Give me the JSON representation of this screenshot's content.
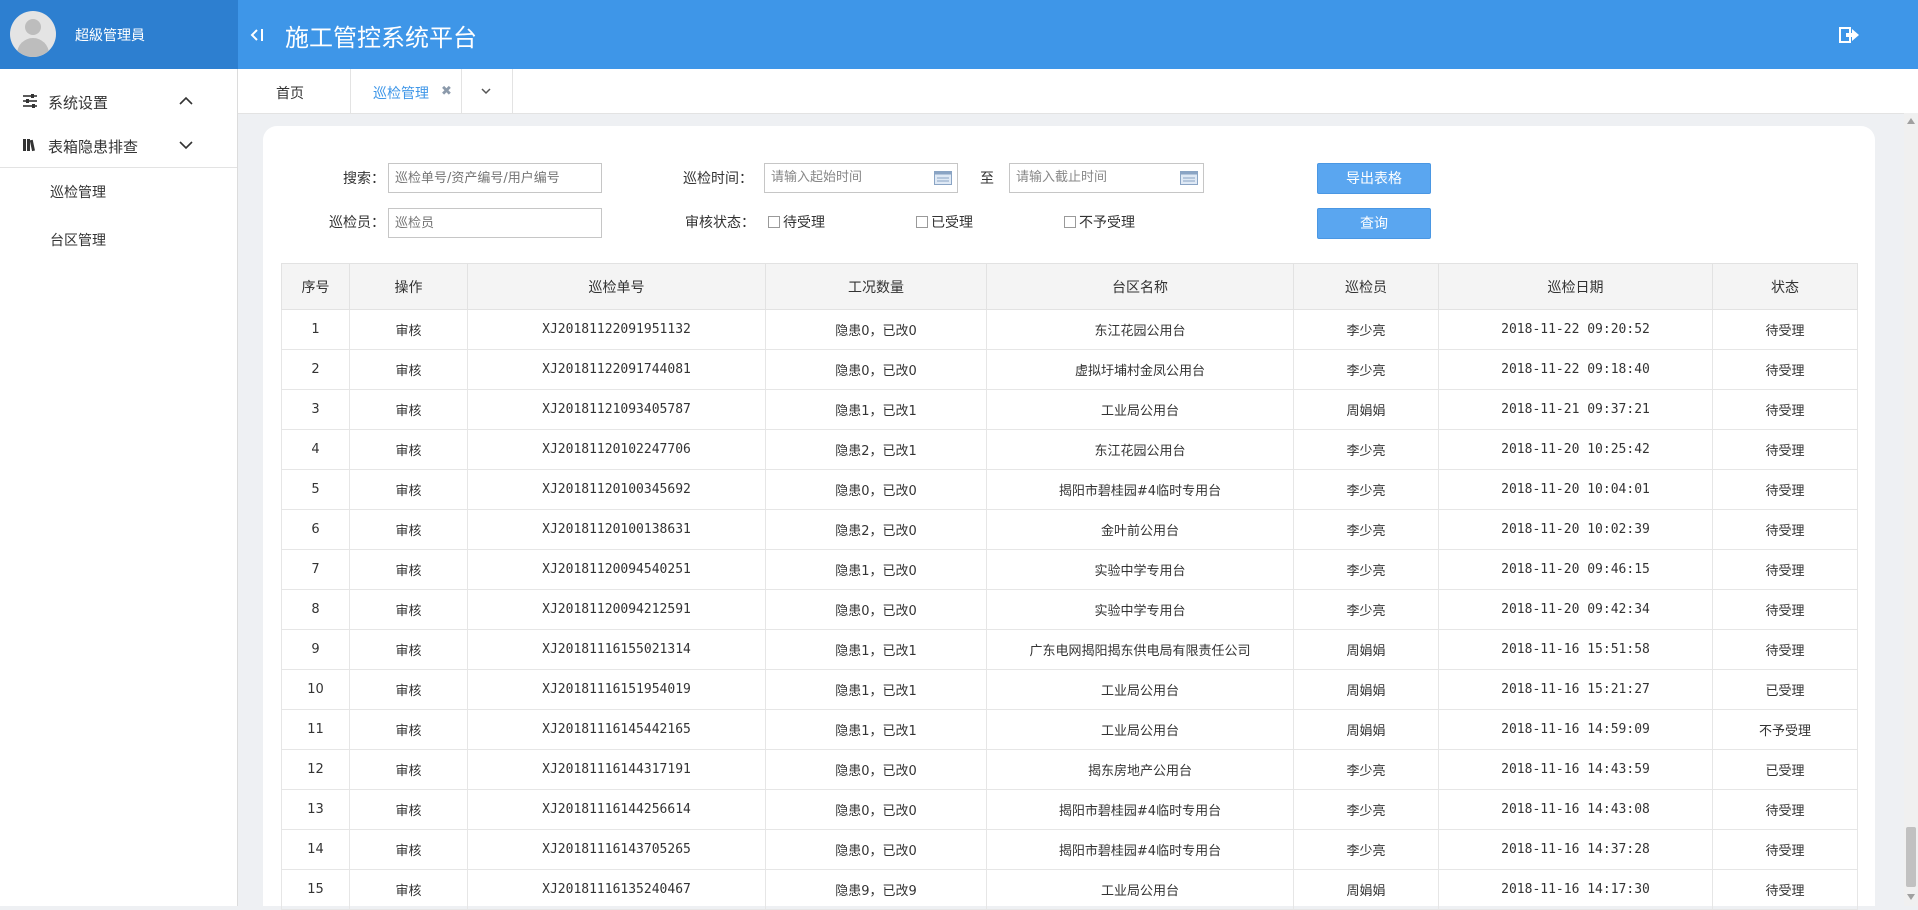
{
  "header": {
    "user_name": "超級管理員",
    "title": "施工管控系统平台",
    "accent_color": "#3e96e8",
    "icons": [
      "collapse-icon",
      "logout-icon",
      "avatar"
    ]
  },
  "sidebar": {
    "groups": [
      {
        "label": "系统设置",
        "icon": "sliders-icon",
        "chevron": "up"
      },
      {
        "label": "表箱隐患排查",
        "icon": "books-icon",
        "chevron": "down"
      }
    ],
    "items": [
      {
        "label": "巡检管理"
      },
      {
        "label": "台区管理"
      }
    ]
  },
  "tabs": [
    {
      "label": "首页"
    },
    {
      "label": "巡检管理",
      "active": true,
      "closable": true
    }
  ],
  "filters": {
    "search_label": "搜索：",
    "search_placeholder": "巡检单号/资产编号/用户编号",
    "inspector_label": "巡检员：",
    "inspector_placeholder": "巡检员",
    "time_label": "巡检时间：",
    "start_placeholder": "请输入起始时间",
    "to_label": "至",
    "end_placeholder": "请输入截止时间",
    "status_label": "审核状态：",
    "status_options": [
      "待受理",
      "已受理",
      "不予受理"
    ],
    "export_button": "导出表格",
    "query_button": "查询"
  },
  "table": {
    "headers": [
      "序号",
      "操作",
      "巡检单号",
      "工况数量",
      "台区名称",
      "巡检员",
      "巡检日期",
      "状态"
    ],
    "rows": [
      [
        "1",
        "审核",
        "XJ20181122091951132",
        "隐患0，已改0",
        "东江花园公用台",
        "李少亮",
        "2018-11-22 09:20:52",
        "待受理"
      ],
      [
        "2",
        "审核",
        "XJ20181122091744081",
        "隐患0，已改0",
        "虚拟圩埔村金凤公用台",
        "李少亮",
        "2018-11-22 09:18:40",
        "待受理"
      ],
      [
        "3",
        "审核",
        "XJ20181121093405787",
        "隐患1，已改1",
        "工业局公用台",
        "周娟娟",
        "2018-11-21 09:37:21",
        "待受理"
      ],
      [
        "4",
        "审核",
        "XJ20181120102247706",
        "隐患2，已改1",
        "东江花园公用台",
        "李少亮",
        "2018-11-20 10:25:42",
        "待受理"
      ],
      [
        "5",
        "审核",
        "XJ20181120100345692",
        "隐患0，已改0",
        "揭阳市碧桂园#4临时专用台",
        "李少亮",
        "2018-11-20 10:04:01",
        "待受理"
      ],
      [
        "6",
        "审核",
        "XJ20181120100138631",
        "隐患2，已改0",
        "金叶前公用台",
        "李少亮",
        "2018-11-20 10:02:39",
        "待受理"
      ],
      [
        "7",
        "审核",
        "XJ20181120094540251",
        "隐患1，已改0",
        "实验中学专用台",
        "李少亮",
        "2018-11-20 09:46:15",
        "待受理"
      ],
      [
        "8",
        "审核",
        "XJ20181120094212591",
        "隐患0，已改0",
        "实验中学专用台",
        "李少亮",
        "2018-11-20 09:42:34",
        "待受理"
      ],
      [
        "9",
        "审核",
        "XJ20181116155021314",
        "隐患1，已改1",
        "广东电网揭阳揭东供电局有限责任公司",
        "周娟娟",
        "2018-11-16 15:51:58",
        "待受理"
      ],
      [
        "10",
        "审核",
        "XJ20181116151954019",
        "隐患1，已改1",
        "工业局公用台",
        "周娟娟",
        "2018-11-16 15:21:27",
        "已受理"
      ],
      [
        "11",
        "审核",
        "XJ20181116145442165",
        "隐患1，已改1",
        "工业局公用台",
        "周娟娟",
        "2018-11-16 14:59:09",
        "不予受理"
      ],
      [
        "12",
        "审核",
        "XJ20181116144317191",
        "隐患0，已改0",
        "揭东房地产公用台",
        "李少亮",
        "2018-11-16 14:43:59",
        "已受理"
      ],
      [
        "13",
        "审核",
        "XJ20181116144256614",
        "隐患0，已改0",
        "揭阳市碧桂园#4临时专用台",
        "李少亮",
        "2018-11-16 14:43:08",
        "待受理"
      ],
      [
        "14",
        "审核",
        "XJ20181116143705265",
        "隐患0，已改0",
        "揭阳市碧桂园#4临时专用台",
        "李少亮",
        "2018-11-16 14:37:28",
        "待受理"
      ],
      [
        "15",
        "审核",
        "XJ20181116135240467",
        "隐患9，已改9",
        "工业局公用台",
        "周娟娟",
        "2018-11-16 14:17:30",
        "待受理"
      ]
    ]
  }
}
